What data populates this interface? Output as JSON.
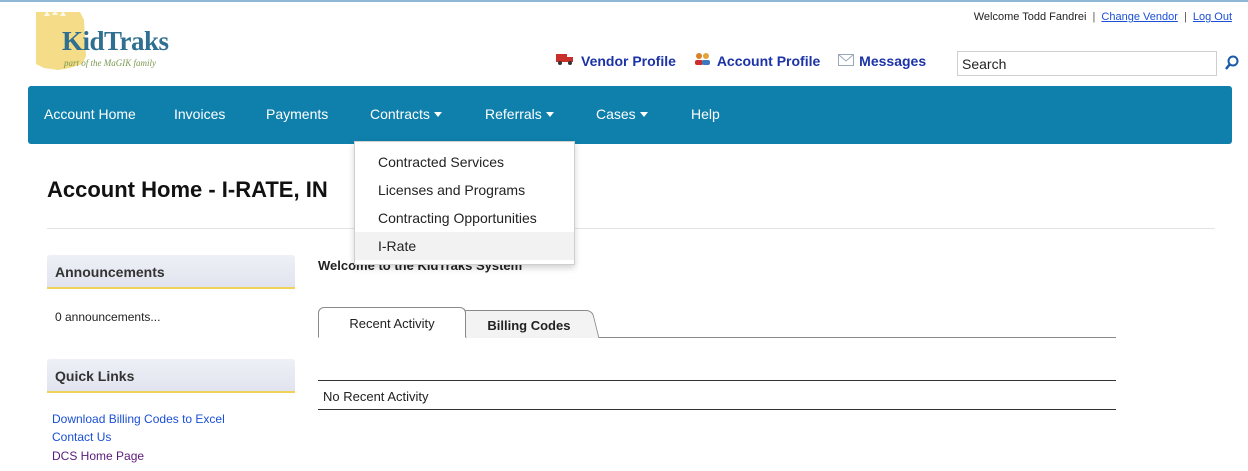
{
  "logo": {
    "name": "KidTraks",
    "tagline": "part of the MaGIK family"
  },
  "header": {
    "welcome_text": "Welcome Todd Fandrei",
    "change_vendor": "Change Vendor",
    "log_out": "Log Out",
    "separator": "|",
    "vendor_profile": "Vendor Profile",
    "account_profile": "Account Profile",
    "messages": "Messages",
    "search_value": "Search"
  },
  "nav": {
    "account_home": "Account Home",
    "invoices": "Invoices",
    "payments": "Payments",
    "contracts": "Contracts",
    "referrals": "Referrals",
    "cases": "Cases",
    "help": "Help",
    "color": "#0f7fab"
  },
  "contracts_menu": {
    "items": [
      "Contracted Services",
      "Licenses and Programs",
      "Contracting Opportunities",
      "I-Rate"
    ],
    "highlighted": "I-Rate"
  },
  "page": {
    "title": "Account Home - I-RATE, IN"
  },
  "sidebar": {
    "announcements_title": "Announcements",
    "announcements_text": "0 announcements...",
    "quick_links_title": "Quick Links",
    "links": [
      "Download Billing Codes to Excel",
      "Contact Us",
      "DCS Home Page"
    ]
  },
  "main": {
    "welcome": "Welcome to the KidTraks System",
    "tabs": [
      "Recent Activity",
      "Billing Codes"
    ],
    "active_tab": "Recent Activity",
    "no_activity": "No Recent Activity"
  },
  "icons": {
    "vendor": "truck-icon",
    "account": "users-icon",
    "messages": "envelope-icon",
    "search": "search-icon"
  },
  "colors": {
    "link": "#1a4fd6",
    "toplink": "#1b33a6",
    "sidebar_accent": "#f0d15a"
  }
}
